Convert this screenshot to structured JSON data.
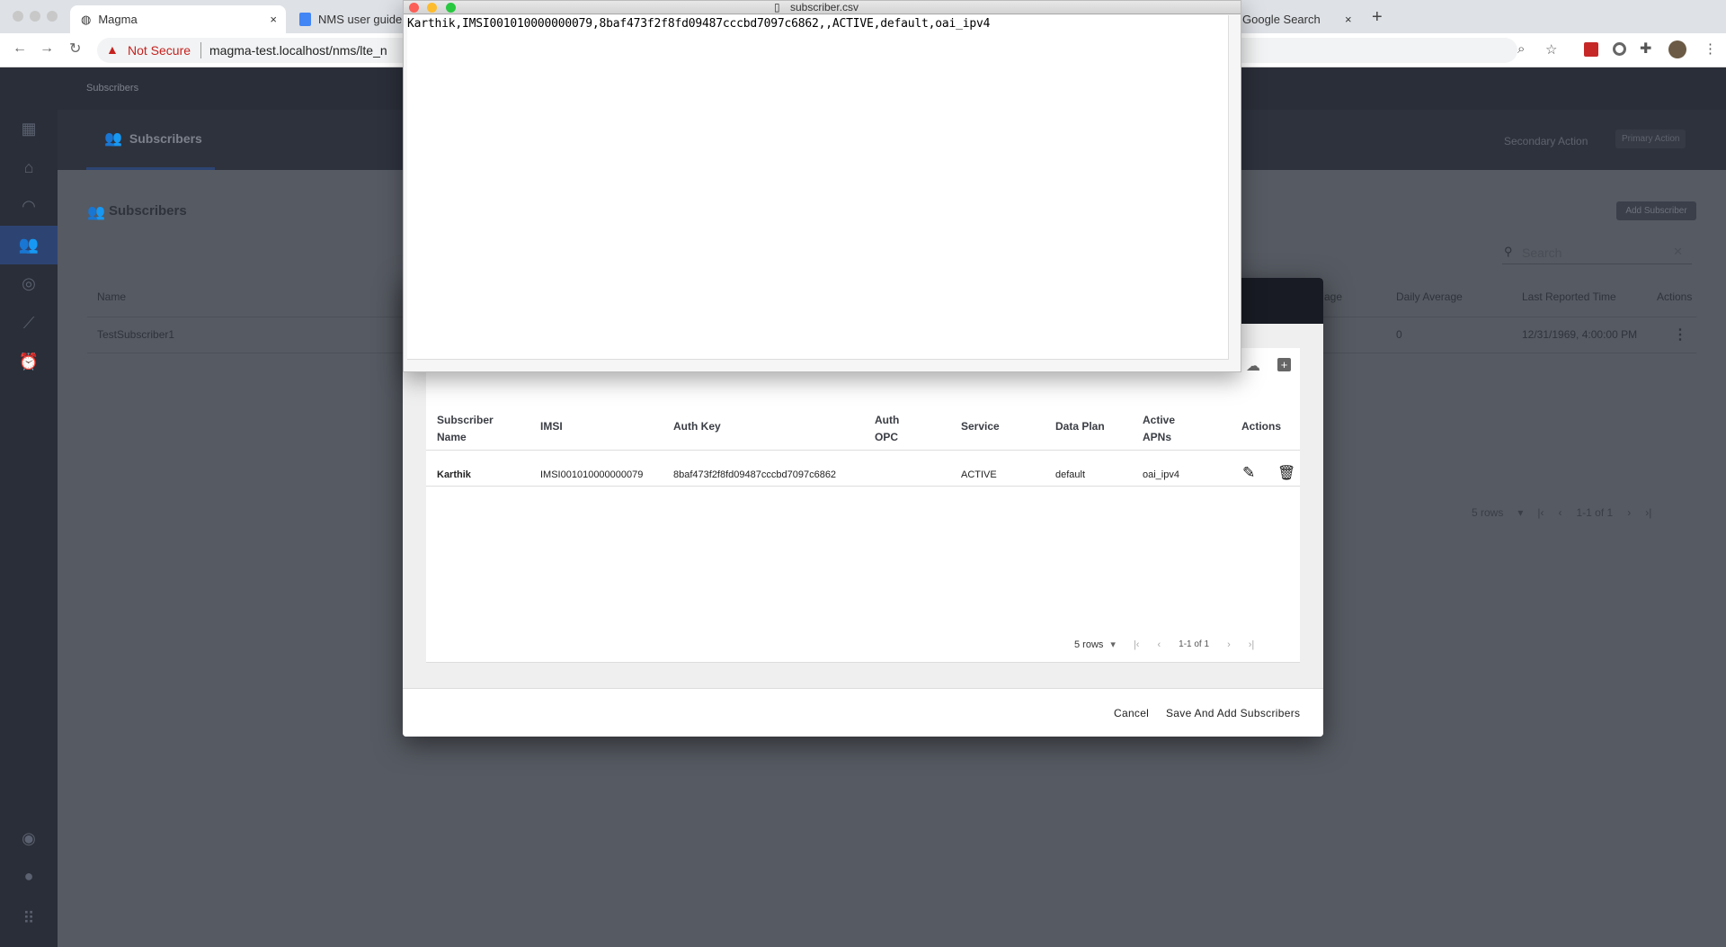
{
  "browser": {
    "tabs": [
      {
        "label": "Magma",
        "close": "×"
      },
      {
        "label": "NMS user guide"
      },
      {
        "label": "Google Search",
        "close": "×"
      }
    ],
    "new_tab": "+",
    "security": "Not Secure",
    "url": "magma-test.localhost/nms/lte_n"
  },
  "app": {
    "breadcrumb": "Subscribers",
    "tab": "Subscribers",
    "secondary_action": "Secondary Action",
    "primary_action": "Primary Action",
    "section_title": "Subscribers",
    "add_subscriber": "Add Subscriber",
    "search_placeholder": "Search",
    "columns": [
      "Name",
      "age",
      "Daily Average",
      "Last Reported Time",
      "Actions"
    ],
    "rows": [
      {
        "name": "TestSubscriber1",
        "daily_average": "0",
        "last_reported": "12/31/1969, 4:00:00 PM"
      }
    ],
    "pagination": {
      "rows": "5 rows",
      "range": "1-1 of 1"
    }
  },
  "modal": {
    "columns": [
      "Subscriber Name",
      "IMSI",
      "Auth Key",
      "Auth OPC",
      "Service",
      "Data Plan",
      "Active APNs",
      "Actions"
    ],
    "rows": [
      {
        "name": "Karthik",
        "imsi": "IMSI001010000000079",
        "auth_key": "8baf473f2f8fd09487cccbd7097c6862",
        "auth_opc": "",
        "service": "ACTIVE",
        "data_plan": "default",
        "apns": "oai_ipv4"
      }
    ],
    "pagination": {
      "rows": "5 rows",
      "range": "1-1 of 1"
    },
    "cancel": "Cancel",
    "save": "Save And Add Subscribers"
  },
  "text_editor": {
    "title": "subscriber.csv",
    "content": "Karthik,IMSI001010000000079,8baf473f2f8fd09487cccbd7097c6862,,ACTIVE,default,oai_ipv4"
  },
  "colors": {
    "accent": "#3f5f9c",
    "not_secure": "#c5221f"
  }
}
